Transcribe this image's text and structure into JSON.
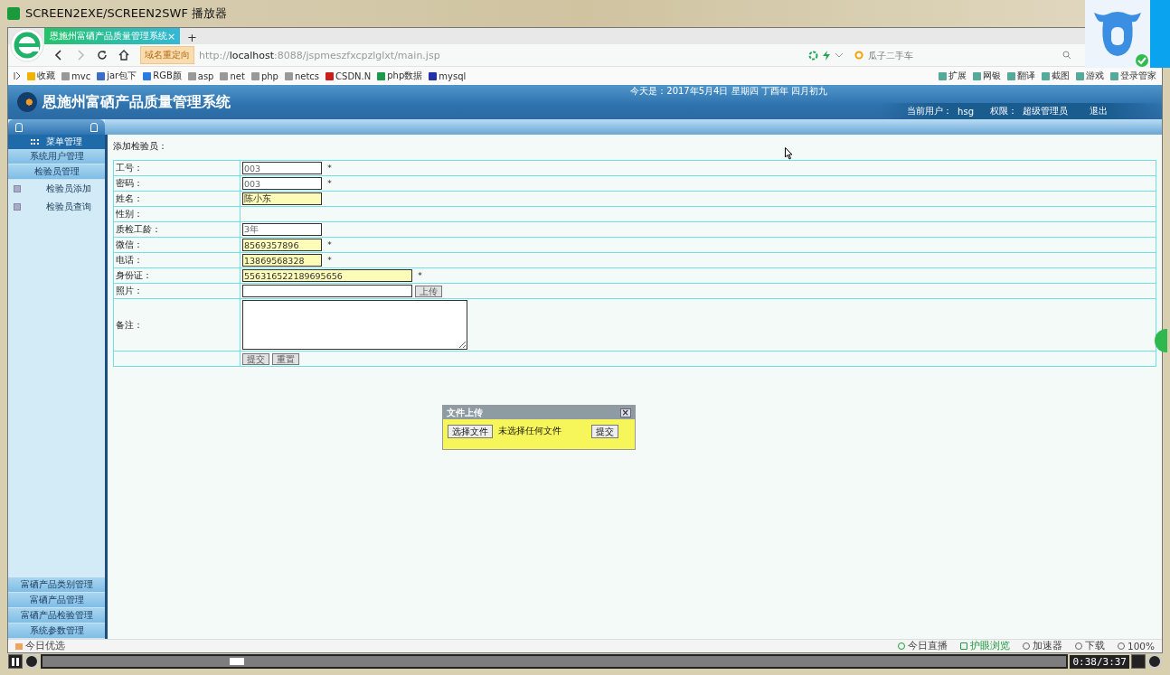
{
  "player": {
    "title": "SCREEN2EXE/SCREEN2SWF 播放器",
    "time": "0:38/3:37",
    "level": 0.19
  },
  "browser": {
    "tab": {
      "title": "恩施州富硒产品质量管理系统",
      "close": "×",
      "selected": true
    },
    "new_tab": "+",
    "redirect_badge": "域名重定向",
    "url": {
      "scheme": "http://",
      "host": "localhost",
      "path": ":8088/jspmeszfxcpzlglxt/main.jsp"
    },
    "search": {
      "placeholder": "瓜子二手车"
    },
    "bookmarks": [
      {
        "label": "收藏",
        "kind": "star"
      },
      {
        "label": "mvc",
        "kind": "page"
      },
      {
        "label": "jar包下",
        "kind": "jar"
      },
      {
        "label": "RGB颜",
        "kind": "rgb"
      },
      {
        "label": "asp",
        "kind": "page"
      },
      {
        "label": "net",
        "kind": "page"
      },
      {
        "label": "php",
        "kind": "page"
      },
      {
        "label": "netcs",
        "kind": "page"
      },
      {
        "label": "CSDN.N",
        "kind": "csdn"
      },
      {
        "label": "php数据",
        "kind": "php"
      },
      {
        "label": "mysql",
        "kind": "paw"
      }
    ],
    "tools": [
      "扩展",
      "网银",
      "翻译",
      "截图",
      "游戏",
      "登录管家"
    ],
    "status_left": "今日优选",
    "status_right": [
      {
        "label": "今日直播",
        "kind": "play"
      },
      {
        "label": "护眼浏览",
        "kind": "phone"
      },
      {
        "label": "加速器",
        "kind": "rocket"
      },
      {
        "label": "下载",
        "kind": "download"
      },
      {
        "label": "100%",
        "kind": "zoom"
      }
    ]
  },
  "page": {
    "system_title": "恩施州富硒产品质量管理系统",
    "date": "今天是：2017年5月4日 星期四 丁酉年 四月初九",
    "user": [
      {
        "label": "当前用户：",
        "value": "hsg"
      },
      {
        "label": "权限：",
        "value": "超级管理员"
      }
    ],
    "logout": "退出",
    "sidebar": {
      "head": "菜单管理",
      "sections": [
        {
          "label": "系统用户管理"
        },
        {
          "label": "检验员管理",
          "children": [
            {
              "label": "检验员添加"
            },
            {
              "label": "检验员查询"
            }
          ]
        }
      ],
      "bottom_sections": [
        "富硒产品类别管理",
        "富硒产品管理",
        "富硒产品检验管理",
        "系统参数管理"
      ]
    },
    "form": {
      "title": "添加检验员：",
      "rows": [
        {
          "kind": "input",
          "label": "工号：",
          "value": "003",
          "highlighted": false,
          "required": "*"
        },
        {
          "kind": "input",
          "label": "密码：",
          "value": "003",
          "highlighted": false,
          "required": "*"
        },
        {
          "kind": "input",
          "label": "姓名：",
          "value": "陈小东",
          "highlighted": true
        },
        {
          "kind": "empty",
          "label": "性别："
        },
        {
          "kind": "input",
          "label": "质检工龄：",
          "value": "3年",
          "highlighted": false
        },
        {
          "kind": "input",
          "label": "微信：",
          "value": "8569357896",
          "highlighted": true,
          "required": "*"
        },
        {
          "kind": "input",
          "label": "电话：",
          "value": "13869568328",
          "highlighted": true,
          "required": "*"
        },
        {
          "kind": "wide_input",
          "label": "身份证：",
          "value": "556316522189695656",
          "highlighted": true,
          "required": "*"
        },
        {
          "kind": "file",
          "label": "照片：",
          "button": "上传"
        },
        {
          "kind": "textarea",
          "label": "备注："
        },
        {
          "kind": "buttons",
          "buttons": [
            "提交",
            "重置"
          ]
        }
      ]
    },
    "upload_dialog": {
      "title": "文件上传",
      "close": "×",
      "choose": "选择文件",
      "status": "未选择任何文件",
      "submit": "提交"
    }
  }
}
